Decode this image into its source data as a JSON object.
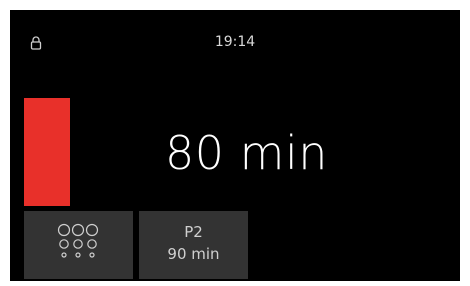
{
  "status_bar": {
    "time": "19:14",
    "lock_icon": "lock-icon"
  },
  "timer": {
    "duration_label": "80 min",
    "bar_color": "#e8302a"
  },
  "tiles": {
    "burners_icon": "burner-grid-icon",
    "program": {
      "label": "P2",
      "time": "90 min"
    }
  },
  "colors": {
    "background": "#000000",
    "tile": "#333333",
    "accent": "#e8302a"
  }
}
